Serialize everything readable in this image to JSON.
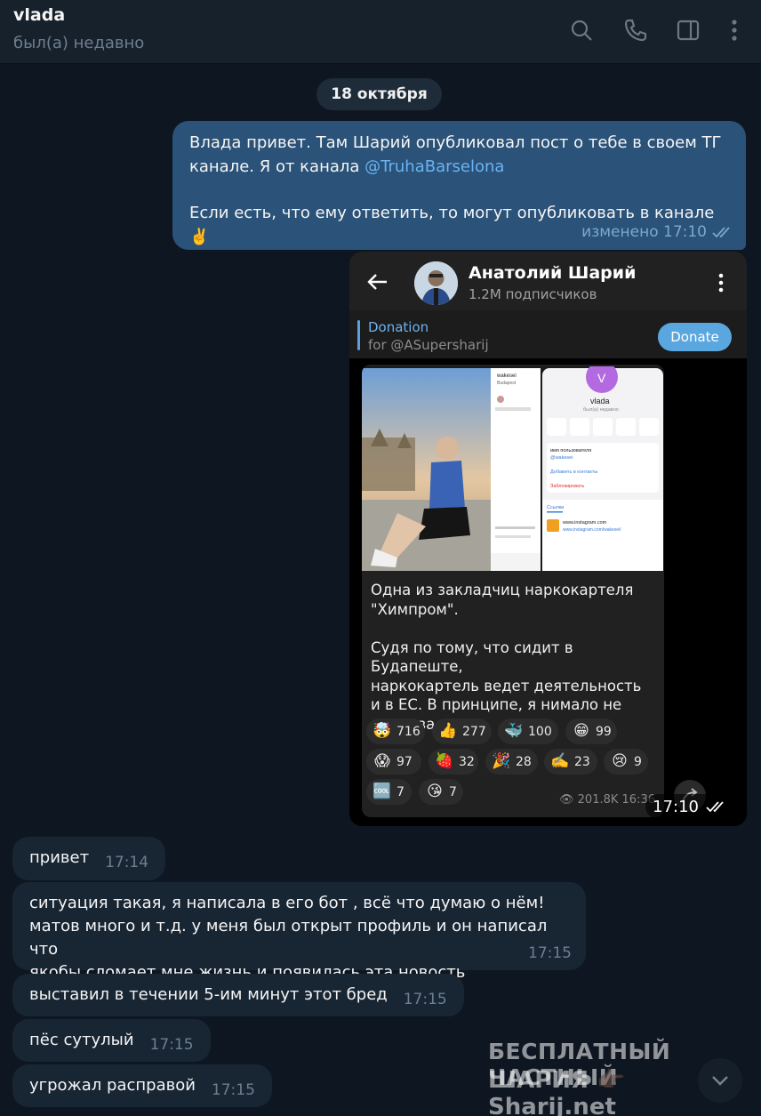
{
  "header": {
    "name": "vlada",
    "status": "был(а) недавно"
  },
  "date_separator": "18 октября",
  "outgoing": {
    "line1": "Влада привет. Там Шарий опубликовал пост о тебе в своем ТГ",
    "line2_prefix": "канале. Я от канала ",
    "line2_link": "@TruhaBarselona",
    "line3": "Если есть, что ему ответить, то могут опубликовать в канале ✌️",
    "meta": "изменено 17:10"
  },
  "screenshot": {
    "channel_name": "Анатолий Шарий",
    "subscribers": "1.2M подписчиков",
    "donation_title": "Donation",
    "donation_sub": "for @ASupersharij",
    "donate_button": "Donate",
    "post_text_1": "Одна из закладчиц наркокартеля",
    "post_text_2": "\"Химпром\".",
    "post_text_3": "Судя по тому, что сидит в Будапеште,",
    "post_text_4": "наркокартель ведет деятельность",
    "post_text_5": "и в ЕС. В принципе, я нимало не",
    "post_text_6": "сомневался.",
    "reactions": [
      {
        "emoji": "🤯",
        "count": "716"
      },
      {
        "emoji": "👍",
        "count": "277"
      },
      {
        "emoji": "🐳",
        "count": "100"
      },
      {
        "emoji": "😁",
        "count": "99"
      },
      {
        "emoji": "😱",
        "count": "97"
      },
      {
        "emoji": "🍓",
        "count": "32"
      },
      {
        "emoji": "🎉",
        "count": "28"
      },
      {
        "emoji": "✍️",
        "count": "23"
      },
      {
        "emoji": "😢",
        "count": "9"
      },
      {
        "emoji": "🆒",
        "count": "7"
      },
      {
        "emoji": "😘",
        "count": "7"
      }
    ],
    "post_views": "👁 201.8K 16:36",
    "inner_profile_letter": "V",
    "inner_profile_name": "vlada",
    "inner_profile_status": "был(а) недавно",
    "inner_username_label": "имя пользователя",
    "inner_username": "@wakesei",
    "inner_add_contact": "Добавить в контакты",
    "inner_block": "Заблокировать",
    "inner_links": "Ссылки",
    "inner_site": "www.instagram.com",
    "inner_site_sub": "www.instagram.com/wakesei/",
    "inner_ig_user": "wakesei",
    "inner_ig_loc": "Budapest",
    "time": "17:10"
  },
  "incoming": [
    {
      "text": "привет",
      "time": "17:14"
    },
    {
      "line1": "ситуация такая, я написала в его бот , всё что думаю о нём!",
      "line2": "матов много и т.д. у меня был открыт профиль и он написал что",
      "line3": "якобы сломает мне жизнь и появилась эта новость",
      "time": "17:15"
    },
    {
      "text": "выставил в течении 5-им минут этот бред",
      "time": "17:15"
    },
    {
      "text": "пёс сутулый",
      "time": "17:15"
    },
    {
      "text": "угрожал расправой",
      "time": "17:15"
    }
  ],
  "watermark": {
    "line1": "БЕСПЛАТНЫЙ ЧАСТНЫЙ",
    "line2": "ШАРИЯ 👉🏿 Sharij.net"
  },
  "colors": {
    "background": "#0e1621",
    "header": "#17212b",
    "outgoing_bubble": "#2b5278",
    "incoming_bubble": "#182533",
    "link": "#6ab3f3"
  }
}
